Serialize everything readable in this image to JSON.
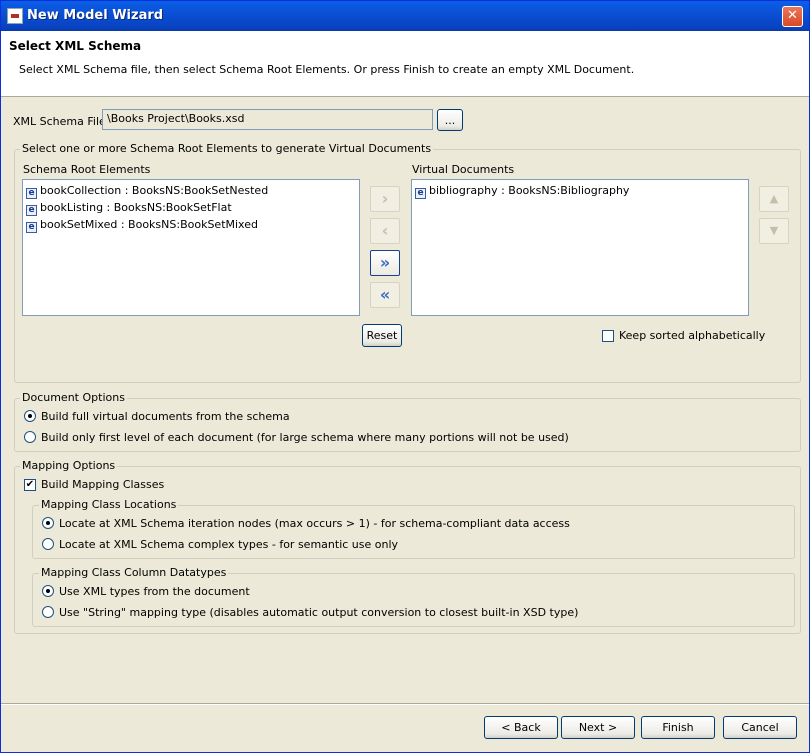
{
  "window": {
    "title": "New Model Wizard",
    "close_glyph": "✕"
  },
  "header": {
    "title": "Select XML Schema",
    "description": "Select XML Schema file, then select Schema Root Elements. Or press Finish to create an empty XML Document."
  },
  "schema_file": {
    "label": "XML Schema File:",
    "value": "\\Books Project\\Books.xsd",
    "browse_label": "..."
  },
  "selection_group": {
    "label": "Select one or more Schema Root Elements to generate Virtual Documents",
    "root_elements_label": "Schema Root Elements",
    "root_elements": [
      "bookCollection : BooksNS:BookSetNested",
      "bookListing : BooksNS:BookSetFlat",
      "bookSetMixed : BooksNS:BookSetMixed"
    ],
    "virtual_documents_label": "Virtual Documents",
    "virtual_documents": [
      "bibliography : BooksNS:Bibliography"
    ],
    "item_icon_glyph": "e",
    "move_right_glyph": "›",
    "move_left_glyph": "‹",
    "move_all_right_glyph": "»",
    "move_all_left_glyph": "«",
    "move_up_glyph": "▲",
    "move_down_glyph": "▼",
    "reset_label": "Reset",
    "keep_sorted_label": "Keep sorted alphabetically",
    "keep_sorted_checked": false
  },
  "document_options": {
    "label": "Document Options",
    "options": [
      "Build full virtual documents from the schema",
      "Build only first level of each document (for large schema where many portions will not be used)"
    ],
    "selected": 0
  },
  "mapping_options": {
    "label": "Mapping Options",
    "build_mapping_label": "Build Mapping Classes",
    "build_mapping_checked": true,
    "check_glyph": "✔",
    "locations": {
      "label": "Mapping Class Locations",
      "options": [
        "Locate at XML Schema iteration nodes (max occurs > 1) - for schema-compliant data access",
        "Locate at XML Schema complex types - for semantic use only"
      ],
      "selected": 0
    },
    "datatypes": {
      "label": "Mapping Class Column Datatypes",
      "options": [
        "Use XML types from the document",
        "Use \"String\" mapping type (disables automatic output conversion to closest built-in XSD type)"
      ],
      "selected": 0
    }
  },
  "footer": {
    "back_label": "< Back",
    "next_label": "Next >",
    "finish_label": "Finish",
    "cancel_label": "Cancel"
  }
}
